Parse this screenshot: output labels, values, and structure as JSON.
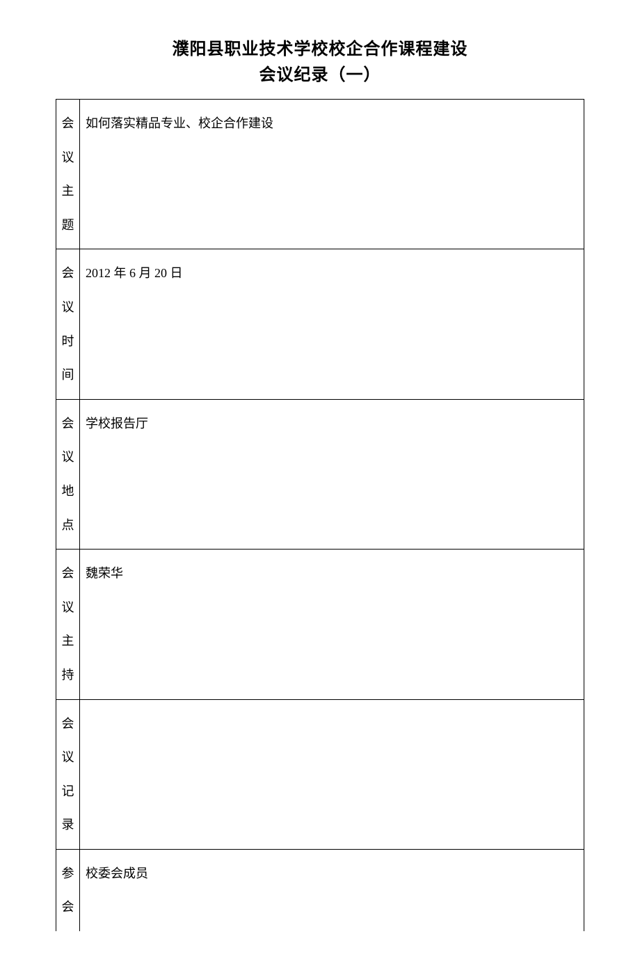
{
  "header": {
    "title1": "濮阳县职业技术学校校企合作课程建设",
    "title2": "会议纪录（一）"
  },
  "rows": [
    {
      "label": "会议主题",
      "value": "如何落实精品专业、校企合作建设"
    },
    {
      "label": "会议时间",
      "value": "2012 年 6 月 20 日"
    },
    {
      "label": "会议地点",
      "value": "学校报告厅"
    },
    {
      "label": "会议主持",
      "value": "魏荣华"
    },
    {
      "label": "会议记录",
      "value": ""
    },
    {
      "label": "参会",
      "value": "校委会成员"
    }
  ]
}
